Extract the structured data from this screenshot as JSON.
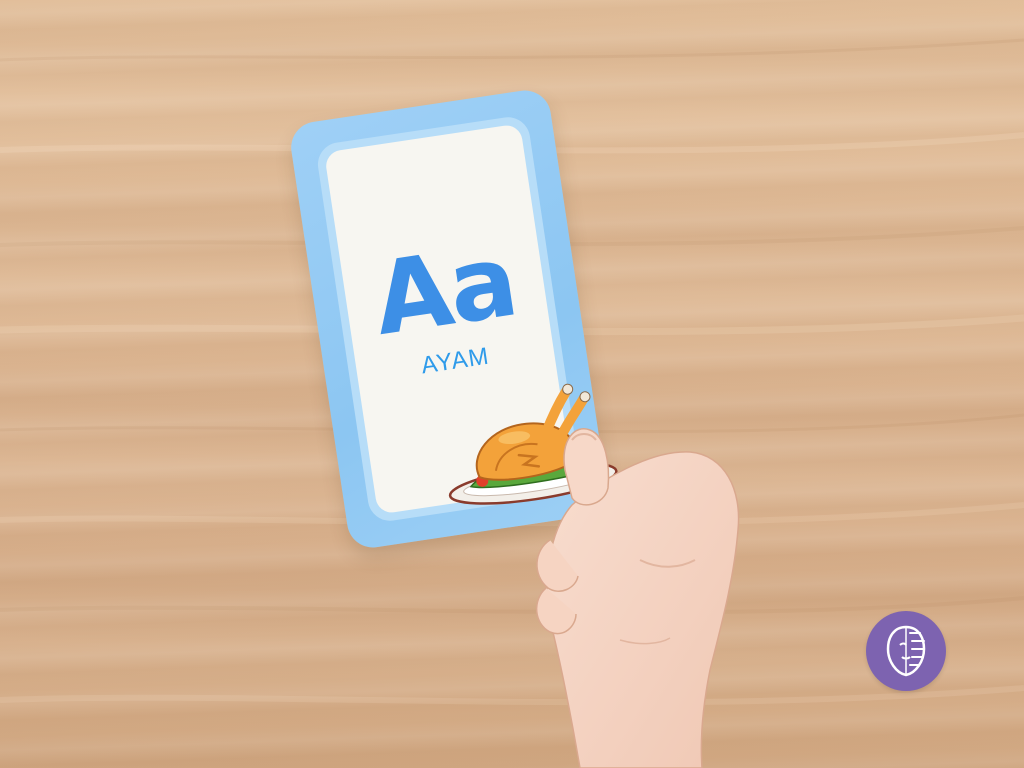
{
  "card": {
    "letter": "Aa",
    "word": "AYAM"
  },
  "icons": {
    "chicken": "roast-chicken-icon",
    "logo": "face-logo-icon"
  },
  "colors": {
    "card_border": "#8cc6f2",
    "card_face": "#f7f6f1",
    "letter": "#3d8fe6",
    "word": "#2f9bea",
    "logo_bg": "#7d63b0",
    "table": "#ddb793"
  }
}
